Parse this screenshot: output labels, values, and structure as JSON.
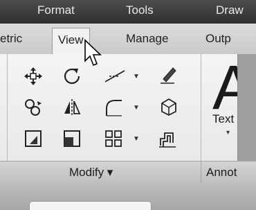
{
  "menubar": {
    "items": [
      "Format",
      "Tools",
      "Draw"
    ]
  },
  "tabs": {
    "items": [
      "etric",
      "View",
      "Manage",
      "Outp"
    ],
    "active": "View"
  },
  "tools": {
    "move_icon": "move-icon",
    "rotate_icon": "rotate-icon",
    "trim_icon": "trim-extend-icon",
    "erase_icon": "erase-icon",
    "copy_icon": "copy-icon",
    "mirror_icon": "mirror-icon",
    "fillet_icon": "fillet-icon",
    "solid_edit_icon": "solid-editing-icon",
    "stretch_icon": "stretch-icon",
    "scale_icon": "scale-icon",
    "array_icon": "array-icon",
    "offset_icon": "offset-icon",
    "text_big": "A",
    "text_label": "Text"
  },
  "panel": {
    "modify_title": "Modify ▾",
    "annot_title": "Annot"
  }
}
